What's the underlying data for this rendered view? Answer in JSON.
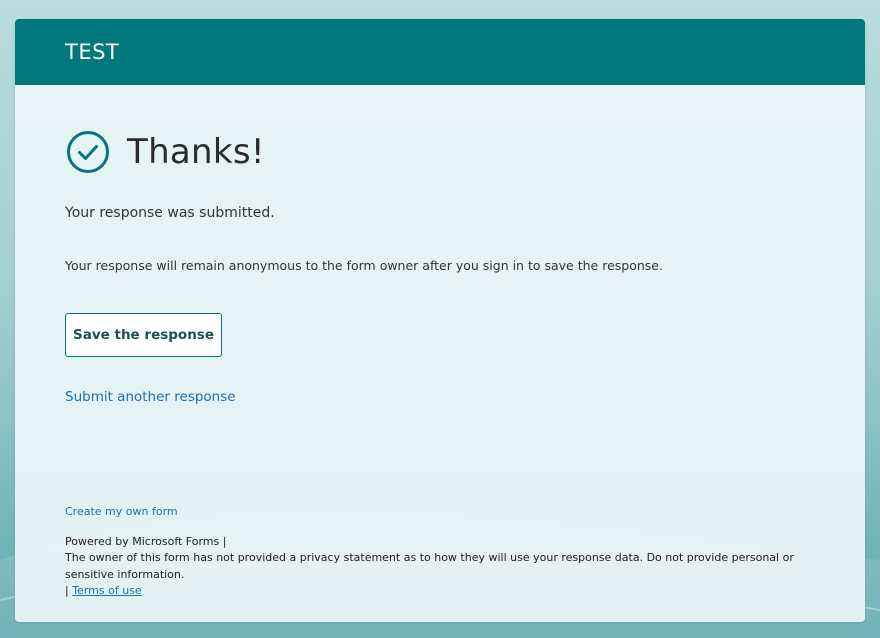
{
  "header": {
    "title": "TEST"
  },
  "confirmation": {
    "heading": "Thanks!",
    "submitted_message": "Your response was submitted.",
    "anonymous_message": "Your response will remain anonymous to the form owner after you sign in to save the response.",
    "save_button_label": "Save the response",
    "submit_another_label": "Submit another response"
  },
  "footer": {
    "create_form_label": "Create my own form",
    "powered_by": "Powered by Microsoft Forms |",
    "privacy_notice": "The owner of this form has not provided a privacy statement as to how they will use your response data. Do not provide personal or sensitive information.",
    "separator": "|",
    "terms_label": "Terms of use"
  },
  "icons": {
    "success": "check-circle-icon"
  },
  "colors": {
    "brand": "#03787c",
    "link": "#1f6fb2",
    "card_background": "#ebf5f6",
    "text": "#333333"
  }
}
